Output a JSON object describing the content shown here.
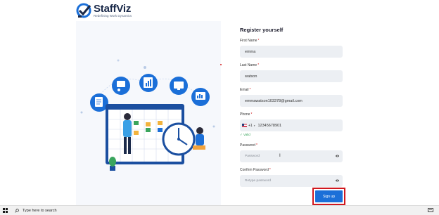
{
  "brand": {
    "name": "StaffViz",
    "tagline": "Redefining Work Dynamics",
    "color": "#1b6fd8"
  },
  "form": {
    "title": "Register yourself",
    "first_name": {
      "label": "First Name",
      "value": "emma"
    },
    "last_name": {
      "label": "Last Name",
      "value": "watson"
    },
    "email": {
      "label": "Email",
      "value": "emmawatson103378@gmail.com"
    },
    "phone": {
      "label": "Phone",
      "country_code": "+1",
      "value": "12345678901",
      "status": "✓ Valid"
    },
    "password": {
      "label": "Password",
      "placeholder": "Password"
    },
    "confirm_password": {
      "label": "Confirm Password",
      "placeholder": "Retype password"
    },
    "submit_label": "Sign up",
    "required_marker": "*"
  },
  "taskbar": {
    "search_placeholder": "Type here to search"
  }
}
